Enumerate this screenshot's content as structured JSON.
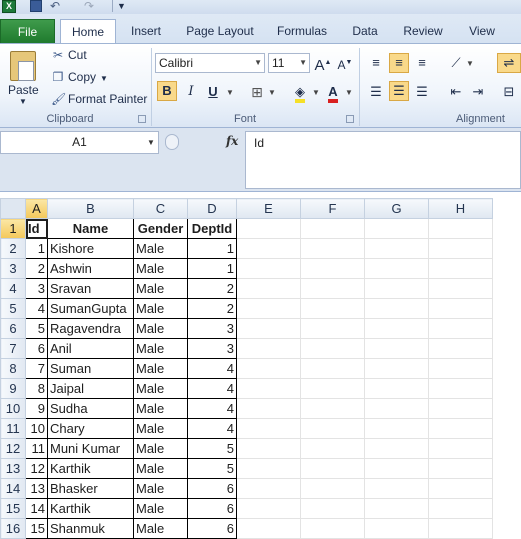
{
  "qat": {
    "app_icon": "X",
    "save_icon": "save-icon",
    "undo_icon": "undo-icon",
    "redo_icon": "redo-icon"
  },
  "tabs": [
    "File",
    "Home",
    "Insert",
    "Page Layout",
    "Formulas",
    "Data",
    "Review",
    "View"
  ],
  "ribbon": {
    "clipboard": {
      "paste": "Paste",
      "cut": "Cut",
      "copy": "Copy",
      "format_painter": "Format Painter",
      "label": "Clipboard"
    },
    "font": {
      "name": "Calibri",
      "size": "11",
      "bold": "B",
      "italic": "I",
      "underline": "U",
      "label": "Font"
    },
    "alignment": {
      "label": "Alignment"
    }
  },
  "formula_bar": {
    "name_box": "A1",
    "fx": "fx",
    "value": "Id"
  },
  "columns": [
    "A",
    "B",
    "C",
    "D",
    "E",
    "F",
    "G",
    "H"
  ],
  "rows": [
    "1",
    "2",
    "3",
    "4",
    "5",
    "6",
    "7",
    "8",
    "9",
    "10",
    "11",
    "12",
    "13",
    "14",
    "15",
    "16"
  ],
  "table": {
    "headers": [
      "Id",
      "Name",
      "Gender",
      "DeptId"
    ],
    "rows": [
      [
        "1",
        "Kishore",
        "Male",
        "1"
      ],
      [
        "2",
        "Ashwin",
        "Male",
        "1"
      ],
      [
        "3",
        "Sravan",
        "Male",
        "2"
      ],
      [
        "4",
        "SumanGupta",
        "Male",
        "2"
      ],
      [
        "5",
        "Ragavendra",
        "Male",
        "3"
      ],
      [
        "6",
        "Anil",
        "Male",
        "3"
      ],
      [
        "7",
        "Suman",
        "Male",
        "4"
      ],
      [
        "8",
        "Jaipal",
        "Male",
        "4"
      ],
      [
        "9",
        "Sudha",
        "Male",
        "4"
      ],
      [
        "10",
        "Chary",
        "Male",
        "4"
      ],
      [
        "11",
        "Muni Kumar",
        "Male",
        "5"
      ],
      [
        "12",
        "Karthik",
        "Male",
        "5"
      ],
      [
        "13",
        "Bhasker",
        "Male",
        "6"
      ],
      [
        "14",
        "Karthik",
        "Male",
        "6"
      ],
      [
        "15",
        "Shanmuk",
        "Male",
        "6"
      ]
    ]
  }
}
